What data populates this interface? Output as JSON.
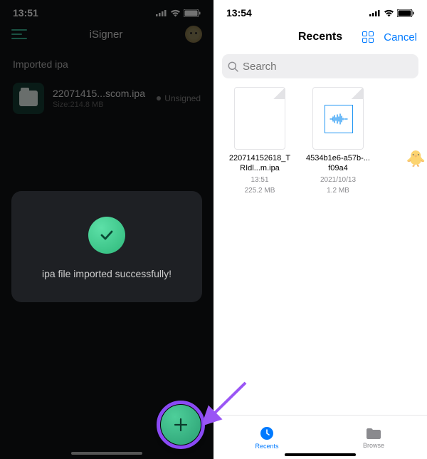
{
  "left": {
    "status_time": "13:51",
    "title": "iSigner",
    "section_title": "Imported ipa",
    "file": {
      "name": "22071415...scom.ipa",
      "size": "Size:214.8 MB",
      "status": "Unsigned"
    },
    "toast_message": "ipa file imported successfully!"
  },
  "right": {
    "status_time": "13:54",
    "title": "Recents",
    "cancel": "Cancel",
    "search_placeholder": "Search",
    "files": [
      {
        "name": "220714152618_TRIdl...m.ipa",
        "time": "13:51",
        "size": "225.2 MB"
      },
      {
        "name": "4534b1e6-a57b-...f09a4",
        "time": "2021/10/13",
        "size": "1.2 MB"
      }
    ],
    "tabs": {
      "recents": "Recents",
      "browse": "Browse"
    }
  }
}
